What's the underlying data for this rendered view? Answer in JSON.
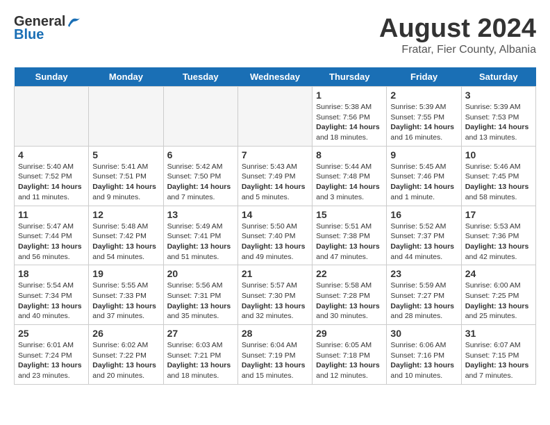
{
  "header": {
    "logo_general": "General",
    "logo_blue": "Blue",
    "title": "August 2024",
    "subtitle": "Fratar, Fier County, Albania"
  },
  "days_of_week": [
    "Sunday",
    "Monday",
    "Tuesday",
    "Wednesday",
    "Thursday",
    "Friday",
    "Saturday"
  ],
  "weeks": [
    [
      {
        "day": "",
        "info": "",
        "empty": true
      },
      {
        "day": "",
        "info": "",
        "empty": true
      },
      {
        "day": "",
        "info": "",
        "empty": true
      },
      {
        "day": "",
        "info": "",
        "empty": true
      },
      {
        "day": "1",
        "info": "Sunrise: 5:38 AM\nSunset: 7:56 PM\nDaylight: 14 hours\nand 18 minutes."
      },
      {
        "day": "2",
        "info": "Sunrise: 5:39 AM\nSunset: 7:55 PM\nDaylight: 14 hours\nand 16 minutes."
      },
      {
        "day": "3",
        "info": "Sunrise: 5:39 AM\nSunset: 7:53 PM\nDaylight: 14 hours\nand 13 minutes."
      }
    ],
    [
      {
        "day": "4",
        "info": "Sunrise: 5:40 AM\nSunset: 7:52 PM\nDaylight: 14 hours\nand 11 minutes."
      },
      {
        "day": "5",
        "info": "Sunrise: 5:41 AM\nSunset: 7:51 PM\nDaylight: 14 hours\nand 9 minutes."
      },
      {
        "day": "6",
        "info": "Sunrise: 5:42 AM\nSunset: 7:50 PM\nDaylight: 14 hours\nand 7 minutes."
      },
      {
        "day": "7",
        "info": "Sunrise: 5:43 AM\nSunset: 7:49 PM\nDaylight: 14 hours\nand 5 minutes."
      },
      {
        "day": "8",
        "info": "Sunrise: 5:44 AM\nSunset: 7:48 PM\nDaylight: 14 hours\nand 3 minutes."
      },
      {
        "day": "9",
        "info": "Sunrise: 5:45 AM\nSunset: 7:46 PM\nDaylight: 14 hours\nand 1 minute."
      },
      {
        "day": "10",
        "info": "Sunrise: 5:46 AM\nSunset: 7:45 PM\nDaylight: 13 hours\nand 58 minutes."
      }
    ],
    [
      {
        "day": "11",
        "info": "Sunrise: 5:47 AM\nSunset: 7:44 PM\nDaylight: 13 hours\nand 56 minutes."
      },
      {
        "day": "12",
        "info": "Sunrise: 5:48 AM\nSunset: 7:42 PM\nDaylight: 13 hours\nand 54 minutes."
      },
      {
        "day": "13",
        "info": "Sunrise: 5:49 AM\nSunset: 7:41 PM\nDaylight: 13 hours\nand 51 minutes."
      },
      {
        "day": "14",
        "info": "Sunrise: 5:50 AM\nSunset: 7:40 PM\nDaylight: 13 hours\nand 49 minutes."
      },
      {
        "day": "15",
        "info": "Sunrise: 5:51 AM\nSunset: 7:38 PM\nDaylight: 13 hours\nand 47 minutes."
      },
      {
        "day": "16",
        "info": "Sunrise: 5:52 AM\nSunset: 7:37 PM\nDaylight: 13 hours\nand 44 minutes."
      },
      {
        "day": "17",
        "info": "Sunrise: 5:53 AM\nSunset: 7:36 PM\nDaylight: 13 hours\nand 42 minutes."
      }
    ],
    [
      {
        "day": "18",
        "info": "Sunrise: 5:54 AM\nSunset: 7:34 PM\nDaylight: 13 hours\nand 40 minutes."
      },
      {
        "day": "19",
        "info": "Sunrise: 5:55 AM\nSunset: 7:33 PM\nDaylight: 13 hours\nand 37 minutes."
      },
      {
        "day": "20",
        "info": "Sunrise: 5:56 AM\nSunset: 7:31 PM\nDaylight: 13 hours\nand 35 minutes."
      },
      {
        "day": "21",
        "info": "Sunrise: 5:57 AM\nSunset: 7:30 PM\nDaylight: 13 hours\nand 32 minutes."
      },
      {
        "day": "22",
        "info": "Sunrise: 5:58 AM\nSunset: 7:28 PM\nDaylight: 13 hours\nand 30 minutes."
      },
      {
        "day": "23",
        "info": "Sunrise: 5:59 AM\nSunset: 7:27 PM\nDaylight: 13 hours\nand 28 minutes."
      },
      {
        "day": "24",
        "info": "Sunrise: 6:00 AM\nSunset: 7:25 PM\nDaylight: 13 hours\nand 25 minutes."
      }
    ],
    [
      {
        "day": "25",
        "info": "Sunrise: 6:01 AM\nSunset: 7:24 PM\nDaylight: 13 hours\nand 23 minutes."
      },
      {
        "day": "26",
        "info": "Sunrise: 6:02 AM\nSunset: 7:22 PM\nDaylight: 13 hours\nand 20 minutes."
      },
      {
        "day": "27",
        "info": "Sunrise: 6:03 AM\nSunset: 7:21 PM\nDaylight: 13 hours\nand 18 minutes."
      },
      {
        "day": "28",
        "info": "Sunrise: 6:04 AM\nSunset: 7:19 PM\nDaylight: 13 hours\nand 15 minutes."
      },
      {
        "day": "29",
        "info": "Sunrise: 6:05 AM\nSunset: 7:18 PM\nDaylight: 13 hours\nand 12 minutes."
      },
      {
        "day": "30",
        "info": "Sunrise: 6:06 AM\nSunset: 7:16 PM\nDaylight: 13 hours\nand 10 minutes."
      },
      {
        "day": "31",
        "info": "Sunrise: 6:07 AM\nSunset: 7:15 PM\nDaylight: 13 hours\nand 7 minutes."
      }
    ]
  ]
}
